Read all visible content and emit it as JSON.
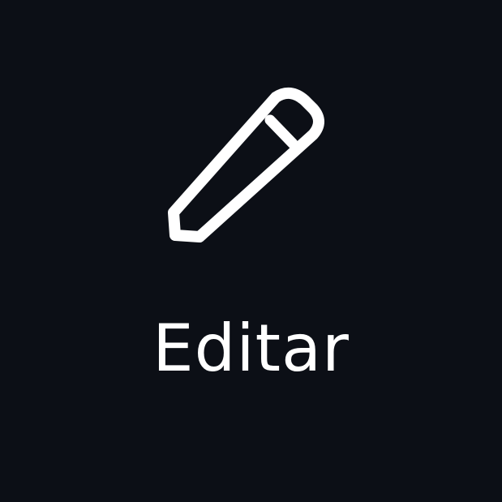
{
  "button": {
    "label": "Editar",
    "icon": "pencil-icon",
    "background_color": "#0c0f16",
    "foreground_color": "#ffffff"
  }
}
